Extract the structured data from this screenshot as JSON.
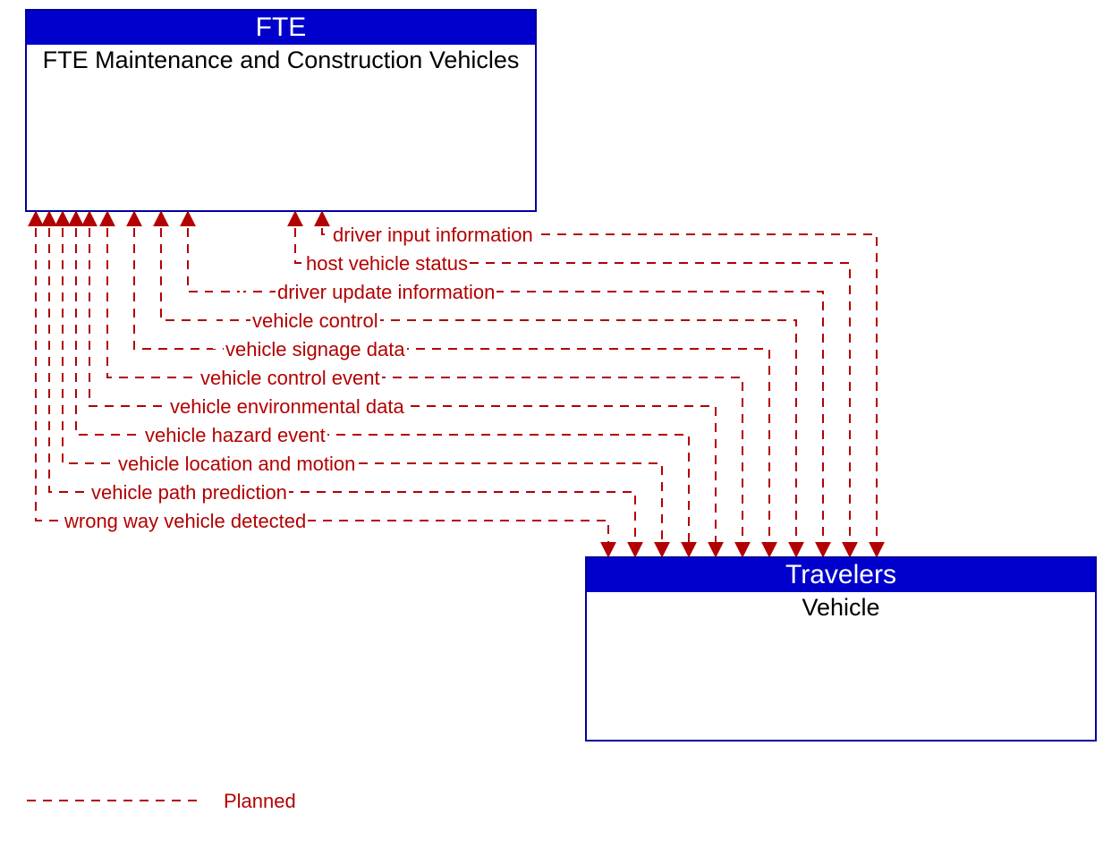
{
  "boxes": {
    "top": {
      "header": "FTE",
      "body": "FTE Maintenance and Construction Vehicles"
    },
    "bottom": {
      "header": "Travelers",
      "body": "Vehicle"
    }
  },
  "flows": [
    "driver input information",
    "host vehicle status",
    "driver update information",
    "vehicle control",
    "vehicle signage data",
    "vehicle control event",
    "vehicle environmental data",
    "vehicle hazard event",
    "vehicle location and motion",
    "vehicle path prediction",
    "wrong way vehicle detected"
  ],
  "legend": {
    "planned": "Planned"
  },
  "colors": {
    "header_bg": "#0000cc",
    "border": "#00009c",
    "flow": "#b30000"
  }
}
